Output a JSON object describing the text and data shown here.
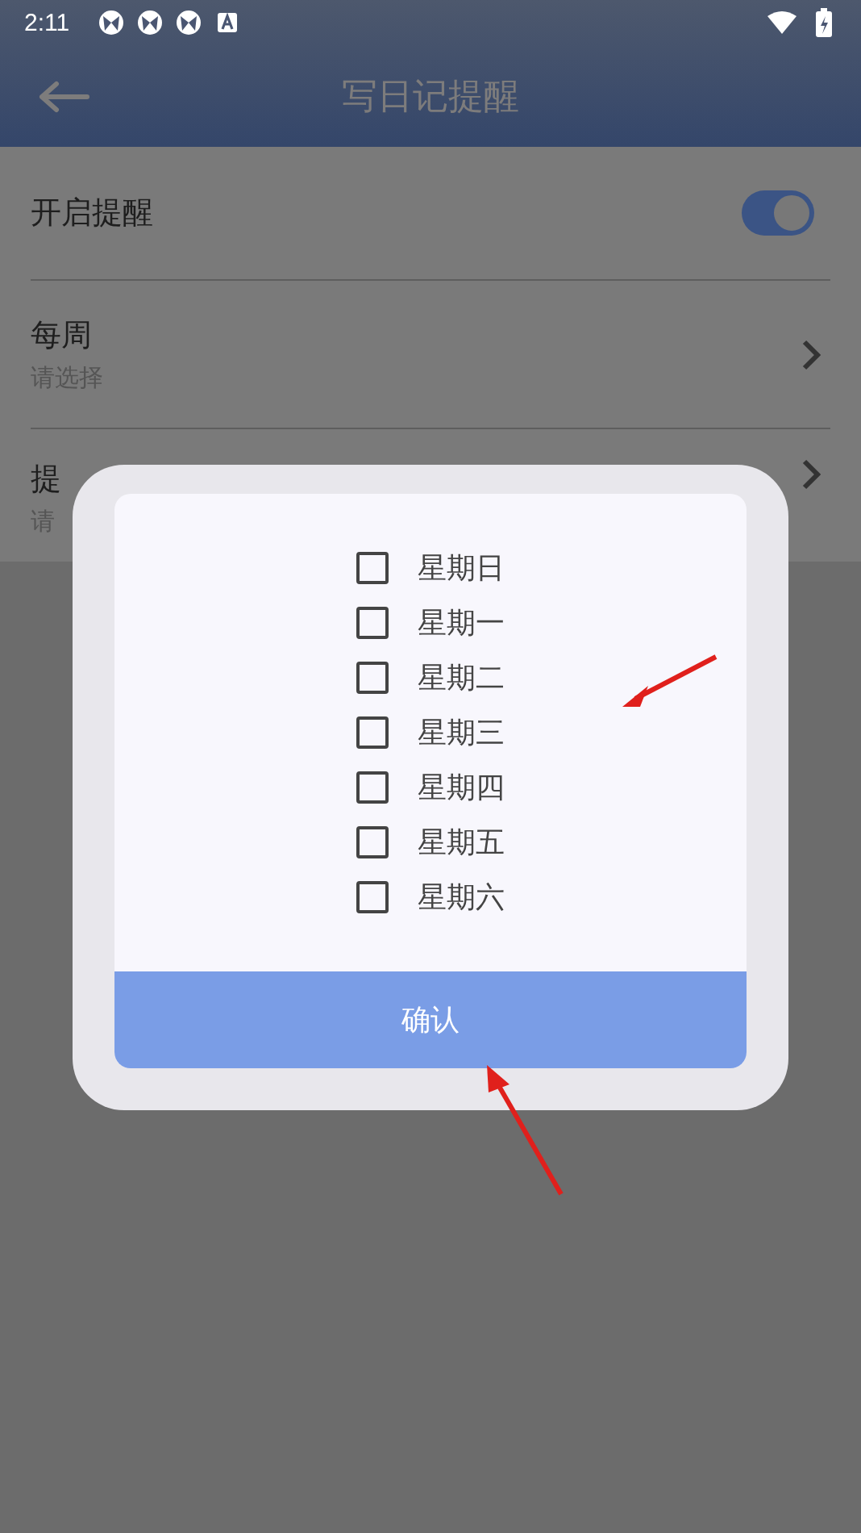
{
  "status_bar": {
    "time": "2:11"
  },
  "header": {
    "title": "写日记提醒"
  },
  "settings": [
    {
      "kind": "toggle",
      "label": "开启提醒",
      "on": true
    },
    {
      "kind": "picker",
      "label": "每周",
      "value": "请选择"
    },
    {
      "kind": "picker",
      "label": "提",
      "value": "请"
    }
  ],
  "dialog": {
    "options": [
      {
        "label": "星期日",
        "checked": false
      },
      {
        "label": "星期一",
        "checked": false
      },
      {
        "label": "星期二",
        "checked": false
      },
      {
        "label": "星期三",
        "checked": false
      },
      {
        "label": "星期四",
        "checked": false
      },
      {
        "label": "星期五",
        "checked": false
      },
      {
        "label": "星期六",
        "checked": false
      }
    ],
    "confirm": "确认"
  }
}
